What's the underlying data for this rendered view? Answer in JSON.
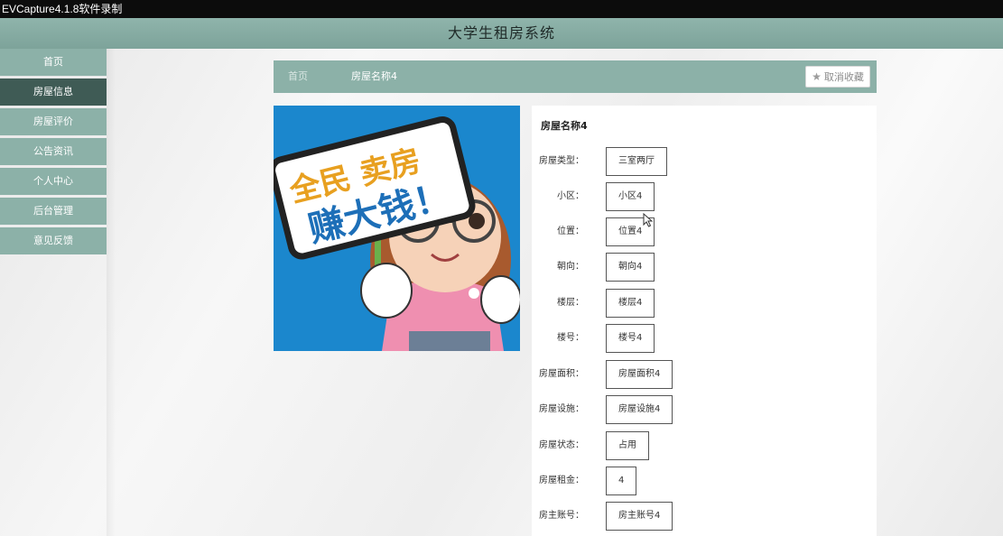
{
  "capture_bar": {
    "text": "EVCapture4.1.8软件录制"
  },
  "app": {
    "title": "大学生租房系统"
  },
  "sidebar": {
    "items": [
      {
        "label": "首页"
      },
      {
        "label": "房屋信息"
      },
      {
        "label": "房屋评价"
      },
      {
        "label": "公告资讯"
      },
      {
        "label": "个人中心"
      },
      {
        "label": "后台管理"
      },
      {
        "label": "意见反馈"
      }
    ]
  },
  "breadcrumb": {
    "home": "首页",
    "current": "房屋名称4",
    "fav_button": "取消收藏"
  },
  "image": {
    "sign_line1": "全民 卖房",
    "sign_line2": "赚大钱！"
  },
  "detail": {
    "title": "房屋名称4",
    "fields": [
      {
        "label": "房屋类型：",
        "value": "三室两厅"
      },
      {
        "label": "小区：",
        "value": "小区4"
      },
      {
        "label": "位置：",
        "value": "位置4"
      },
      {
        "label": "朝向：",
        "value": "朝向4"
      },
      {
        "label": "楼层：",
        "value": "楼层4"
      },
      {
        "label": "楼号：",
        "value": "楼号4"
      },
      {
        "label": "房屋面积：",
        "value": "房屋面积4"
      },
      {
        "label": "房屋设施：",
        "value": "房屋设施4"
      },
      {
        "label": "房屋状态：",
        "value": "占用"
      },
      {
        "label": "房屋租金：",
        "value": "4"
      },
      {
        "label": "房主账号：",
        "value": "房主账号4"
      }
    ]
  },
  "colors": {
    "accent": "#8cb1a8",
    "active": "#3f5b55"
  }
}
